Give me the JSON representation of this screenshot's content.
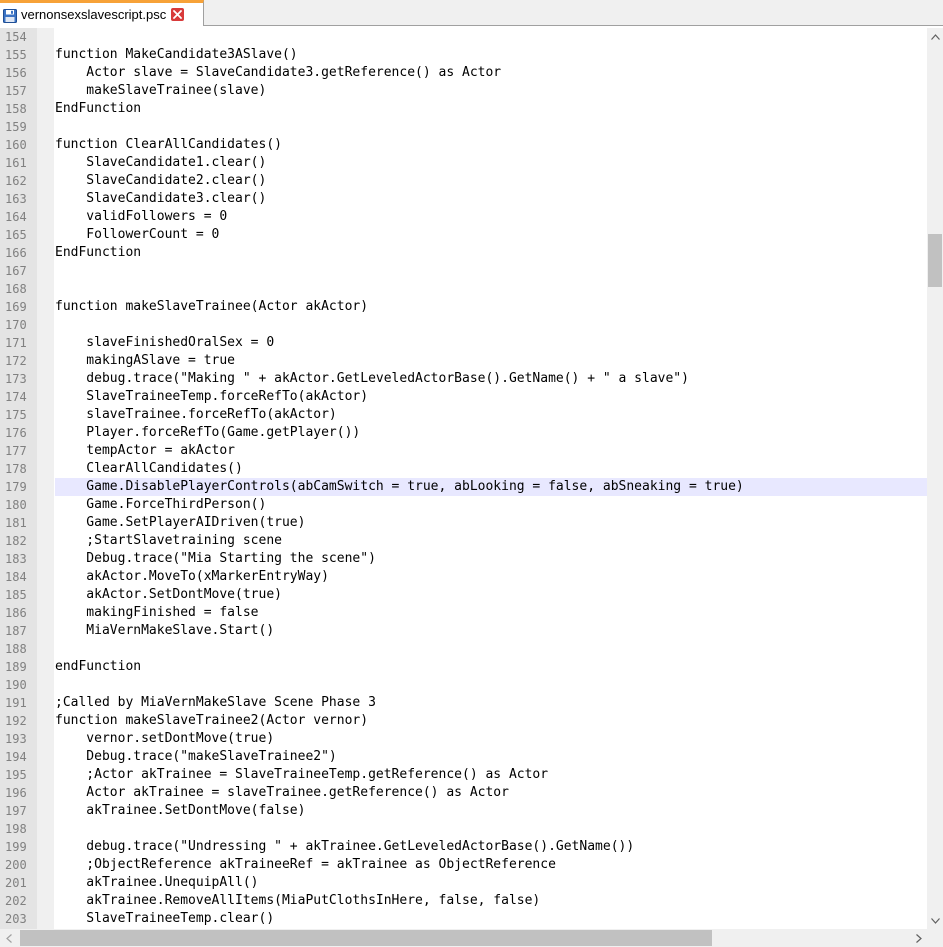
{
  "tab": {
    "filename": "vernonsexslavescript.psc",
    "icon": "save-disk-icon",
    "close_icon": "close-icon"
  },
  "colors": {
    "tab_accent": "#f7a238",
    "close_red": "#d83a3a",
    "current_line": "#e8e8ff",
    "gutter_bg": "#e4e4e4",
    "line_number": "#808080"
  },
  "editor": {
    "current_line": 179,
    "lines": [
      {
        "n": "154",
        "text": ""
      },
      {
        "n": "155",
        "text": "function MakeCandidate3ASlave()"
      },
      {
        "n": "156",
        "text": "    Actor slave = SlaveCandidate3.getReference() as Actor"
      },
      {
        "n": "157",
        "text": "    makeSlaveTrainee(slave)"
      },
      {
        "n": "158",
        "text": "EndFunction"
      },
      {
        "n": "159",
        "text": ""
      },
      {
        "n": "160",
        "text": "function ClearAllCandidates()"
      },
      {
        "n": "161",
        "text": "    SlaveCandidate1.clear()"
      },
      {
        "n": "162",
        "text": "    SlaveCandidate2.clear()"
      },
      {
        "n": "163",
        "text": "    SlaveCandidate3.clear()"
      },
      {
        "n": "164",
        "text": "    validFollowers = 0"
      },
      {
        "n": "165",
        "text": "    FollowerCount = 0"
      },
      {
        "n": "166",
        "text": "EndFunction"
      },
      {
        "n": "167",
        "text": ""
      },
      {
        "n": "168",
        "text": ""
      },
      {
        "n": "169",
        "text": "function makeSlaveTrainee(Actor akActor)"
      },
      {
        "n": "170",
        "text": ""
      },
      {
        "n": "171",
        "text": "    slaveFinishedOralSex = 0"
      },
      {
        "n": "172",
        "text": "    makingASlave = true"
      },
      {
        "n": "173",
        "text": "    debug.trace(\"Making \" + akActor.GetLeveledActorBase().GetName() + \" a slave\")"
      },
      {
        "n": "174",
        "text": "    SlaveTraineeTemp.forceRefTo(akActor)"
      },
      {
        "n": "175",
        "text": "    slaveTrainee.forceRefTo(akActor)"
      },
      {
        "n": "176",
        "text": "    Player.forceRefTo(Game.getPlayer())"
      },
      {
        "n": "177",
        "text": "    tempActor = akActor"
      },
      {
        "n": "178",
        "text": "    ClearAllCandidates()"
      },
      {
        "n": "179",
        "text": "    Game.DisablePlayerControls(abCamSwitch = true, abLooking = false, abSneaking = true)"
      },
      {
        "n": "180",
        "text": "    Game.ForceThirdPerson()"
      },
      {
        "n": "181",
        "text": "    Game.SetPlayerAIDriven(true)"
      },
      {
        "n": "182",
        "text": "    ;StartSlavetraining scene"
      },
      {
        "n": "183",
        "text": "    Debug.trace(\"Mia Starting the scene\")"
      },
      {
        "n": "184",
        "text": "    akActor.MoveTo(xMarkerEntryWay)"
      },
      {
        "n": "185",
        "text": "    akActor.SetDontMove(true)"
      },
      {
        "n": "186",
        "text": "    makingFinished = false"
      },
      {
        "n": "187",
        "text": "    MiaVernMakeSlave.Start()"
      },
      {
        "n": "188",
        "text": ""
      },
      {
        "n": "189",
        "text": "endFunction"
      },
      {
        "n": "190",
        "text": ""
      },
      {
        "n": "191",
        "text": ";Called by MiaVernMakeSlave Scene Phase 3"
      },
      {
        "n": "192",
        "text": "function makeSlaveTrainee2(Actor vernor)"
      },
      {
        "n": "193",
        "text": "    vernor.setDontMove(true)"
      },
      {
        "n": "194",
        "text": "    Debug.trace(\"makeSlaveTrainee2\")"
      },
      {
        "n": "195",
        "text": "    ;Actor akTrainee = SlaveTraineeTemp.getReference() as Actor"
      },
      {
        "n": "196",
        "text": "    Actor akTrainee = slaveTrainee.getReference() as Actor"
      },
      {
        "n": "197",
        "text": "    akTrainee.SetDontMove(false)"
      },
      {
        "n": "198",
        "text": ""
      },
      {
        "n": "199",
        "text": "    debug.trace(\"Undressing \" + akTrainee.GetLeveledActorBase().GetName())"
      },
      {
        "n": "200",
        "text": "    ;ObjectReference akTraineeRef = akTrainee as ObjectReference"
      },
      {
        "n": "201",
        "text": "    akTrainee.UnequipAll()"
      },
      {
        "n": "202",
        "text": "    akTrainee.RemoveAllItems(MiaPutClothsInHere, false, false)"
      },
      {
        "n": "203",
        "text": "    SlaveTraineeTemp.clear()"
      }
    ]
  },
  "scrollbars": {
    "vertical": {
      "up_icon": "arrow-up-icon",
      "down_icon": "arrow-down-icon"
    },
    "horizontal": {
      "left_icon": "arrow-left-icon",
      "right_icon": "arrow-right-icon"
    }
  }
}
